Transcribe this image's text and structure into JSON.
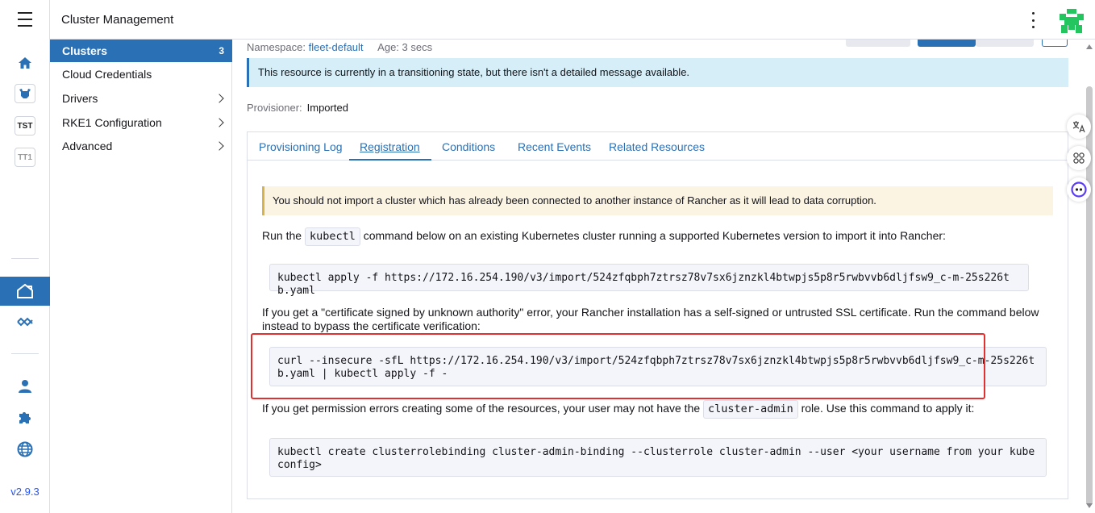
{
  "app": {
    "title": "Cluster Management",
    "version": "v2.9.3"
  },
  "rail": {
    "clusters": [
      "TST",
      "TT1"
    ]
  },
  "sidenav": {
    "items": [
      {
        "label": "Clusters",
        "count": "3"
      },
      {
        "label": "Cloud Credentials"
      },
      {
        "label": "Drivers"
      },
      {
        "label": "RKE1 Configuration"
      },
      {
        "label": "Advanced"
      }
    ]
  },
  "resource": {
    "namespace_label": "Namespace:",
    "namespace": "fleet-default",
    "age": "Age: 3 secs",
    "banner": "This resource is currently in a transitioning state, but there isn't a detailed message available.",
    "provisioner_label": "Provisioner:",
    "provisioner": "Imported"
  },
  "tabs": [
    "Provisioning Log",
    "Registration",
    "Conditions",
    "Recent Events",
    "Related Resources"
  ],
  "registration": {
    "warning": "You should not import a cluster which has already been connected to another instance of Rancher as it will lead to data corruption.",
    "run_pre": "Run the",
    "run_code": "kubectl",
    "run_post": "command below on an existing Kubernetes cluster running a supported Kubernetes version to import it into Rancher:",
    "cmd_apply": "kubectl apply -f https://172.16.254.190/v3/import/524zfqbph7ztrsz78v7sx6jznzkl4btwpjs5p8r5rwbvvb6dljfsw9_c-m-25s226tb.yaml",
    "insecure_text": "If you get a \"certificate signed by unknown authority\" error, your Rancher installation has a self-signed or untrusted SSL certificate. Run the command below instead to bypass the certificate verification:",
    "cmd_curl": "curl --insecure -sfL https://172.16.254.190/v3/import/524zfqbph7ztrsz78v7sx6jznzkl4btwpjs5p8r5rwbvvb6dljfsw9_c-m-25s226tb.yaml | kubectl apply -f -",
    "perm_pre": "If you get permission errors creating some of the resources, your user may not have the",
    "perm_code": "cluster-admin",
    "perm_post": "role. Use this command to apply it:",
    "cmd_binding": "kubectl create clusterrolebinding cluster-admin-binding --clusterrole cluster-admin --user <your username from your kubeconfig>"
  },
  "colors": {
    "accent": "#2a70b5",
    "highlight": "#e0302f"
  }
}
